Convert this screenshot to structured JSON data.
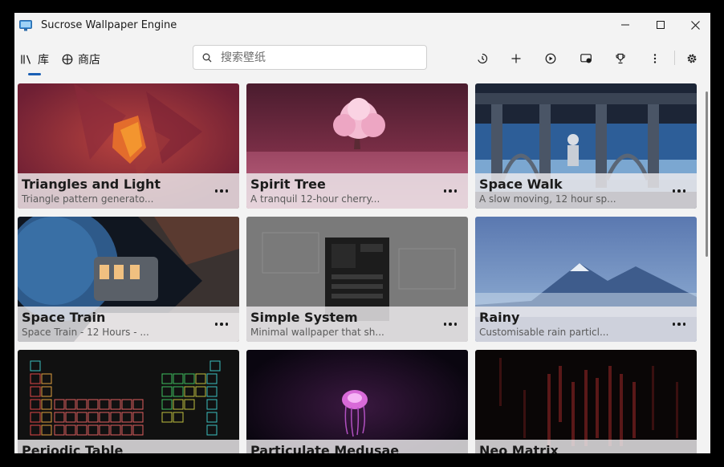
{
  "app": {
    "title": "Sucrose Wallpaper Engine"
  },
  "nav": {
    "library_label": "库",
    "store_label": "商店"
  },
  "search": {
    "placeholder": "搜索壁纸",
    "value": ""
  },
  "toolbar": {
    "icons": [
      "history-icon",
      "add-icon",
      "play-icon",
      "display-icon",
      "trophy-icon",
      "more-vertical-icon",
      "settings-icon"
    ]
  },
  "wallpapers": [
    {
      "title": "Triangles and Light",
      "description": "Triangle pattern generato..."
    },
    {
      "title": "Spirit Tree",
      "description": "A tranquil 12-hour cherry..."
    },
    {
      "title": "Space Walk",
      "description": "A slow moving, 12 hour sp..."
    },
    {
      "title": "Space Train",
      "description": "Space Train - 12 Hours - ..."
    },
    {
      "title": "Simple System",
      "description": "Minimal wallpaper that sh..."
    },
    {
      "title": "Rainy",
      "description": "Customisable rain particl..."
    },
    {
      "title": "Periodic Table",
      "description": ""
    },
    {
      "title": "Particulate Medusae",
      "description": ""
    },
    {
      "title": "Neo Matrix",
      "description": ""
    }
  ]
}
